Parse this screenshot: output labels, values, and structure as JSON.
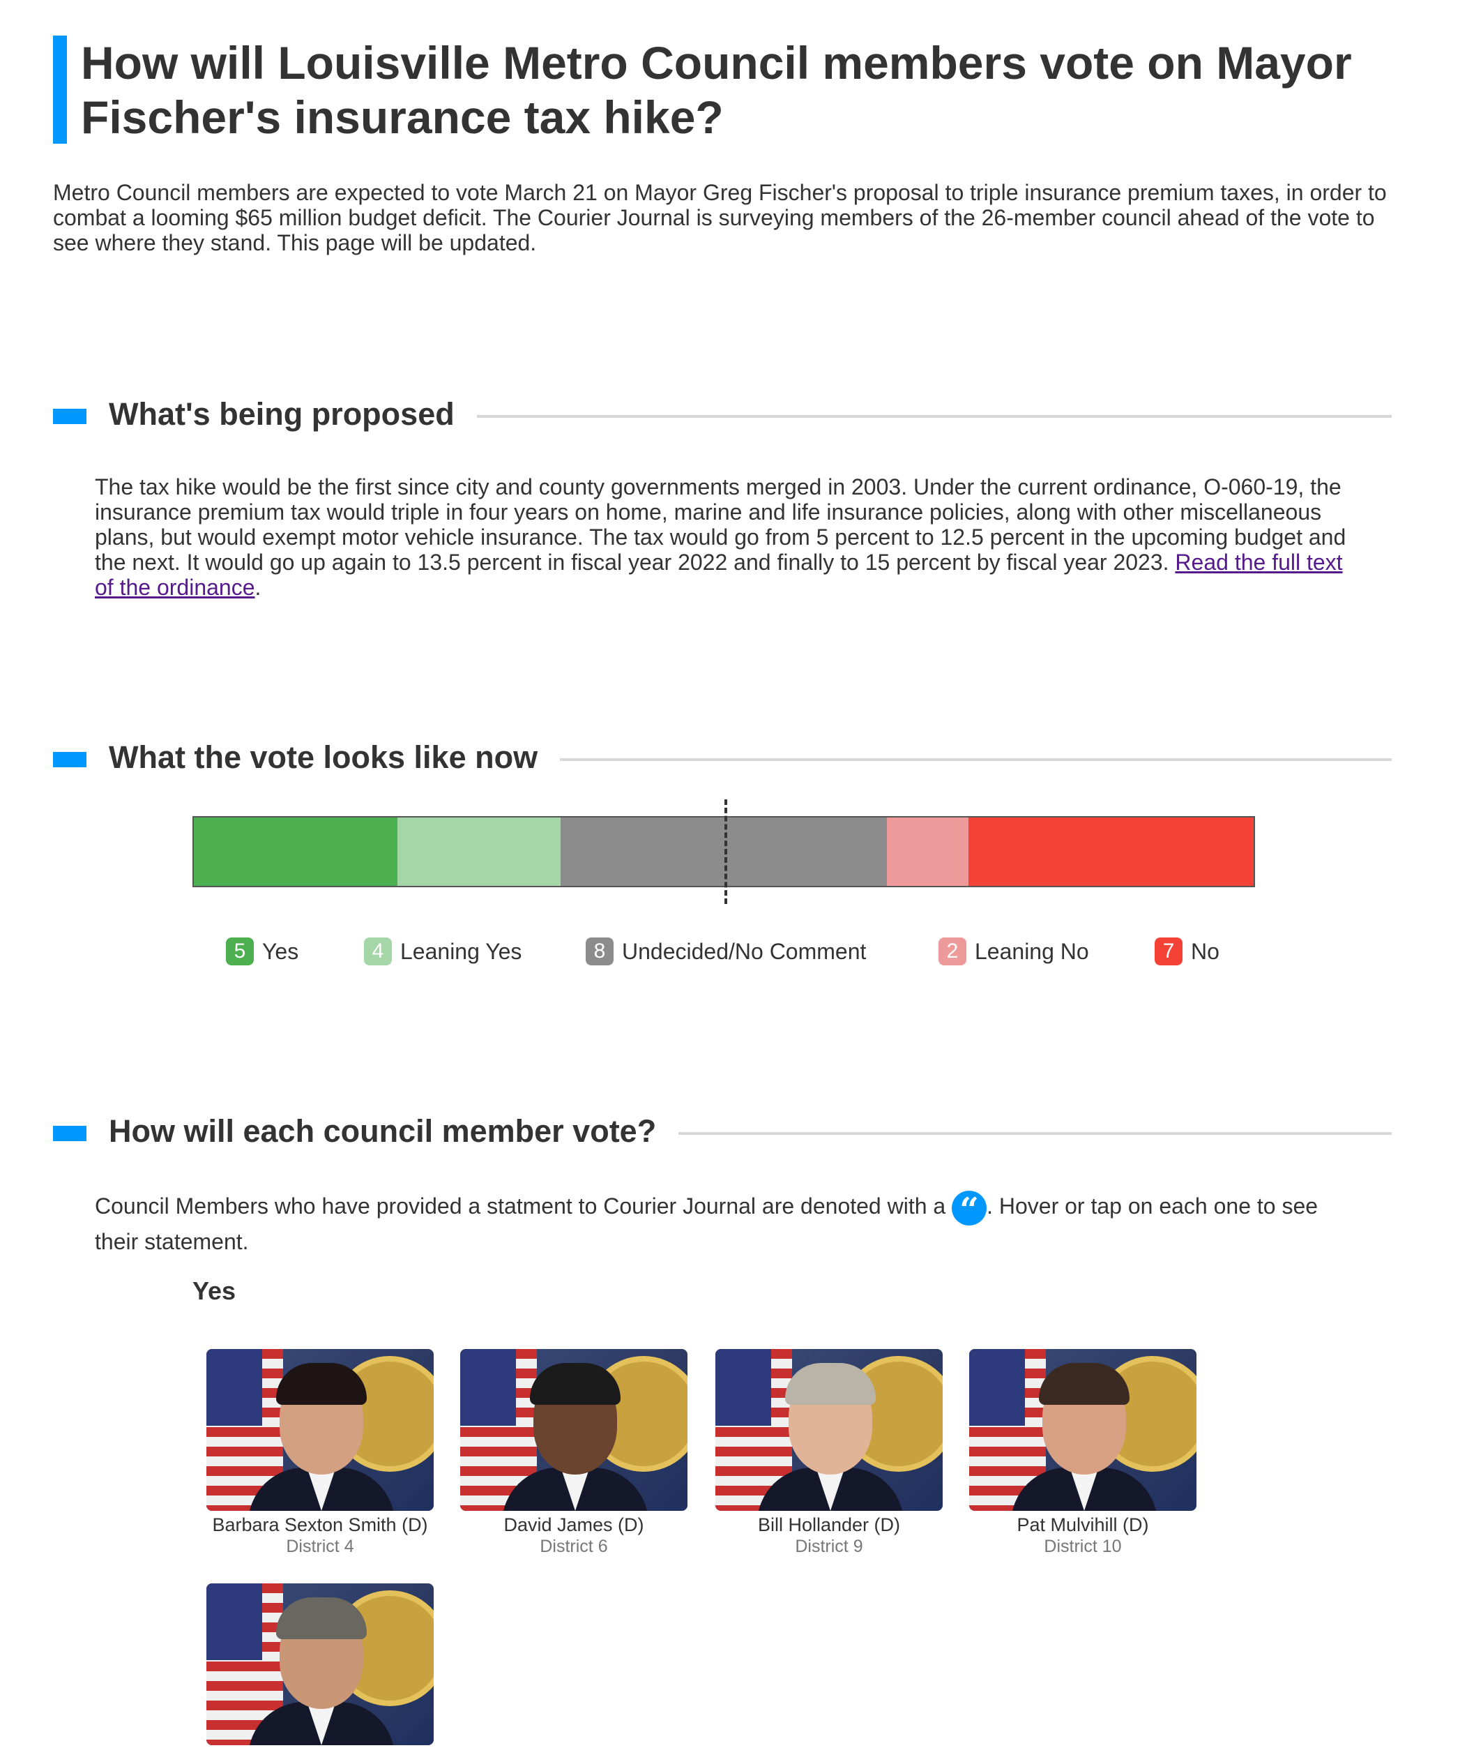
{
  "headline": "How will Louisville Metro Council members vote on Mayor Fischer's insurance tax hike?",
  "intro": "Metro Council members are expected to vote March 21 on Mayor Greg Fischer's proposal to triple insurance premium taxes, in order to combat a looming $65 million budget deficit. The Courier Journal is surveying members of the 26-member council ahead of the vote to see where they stand. This page will be updated.",
  "sections": {
    "proposed": {
      "title": "What's being proposed",
      "text": "The tax hike would be the first since city and county governments merged in 2003. Under the current ordinance, O-060-19, the insurance premium tax would triple in four years on home, marine and life insurance policies, along with other miscellaneous plans, but would exempt motor vehicle insurance. The tax would go from 5 percent to 12.5 percent in the upcoming budget and the next. It would go up again to 13.5 percent in fiscal year 2022 and finally to 15 percent by fiscal year 2023. ",
      "link_text": "Read the full text of the ordinance",
      "after_link": "."
    },
    "vote": {
      "title": "What the vote looks like now"
    },
    "members": {
      "title": "How will each council member vote?",
      "note_before": "Council Members who have provided a statment to Courier Journal are denoted with a ",
      "note_after": ". Hover or tap on each one to see their statement.",
      "quote_glyph": "“",
      "group_label": "Yes"
    }
  },
  "vote_tally": [
    {
      "label": "Yes",
      "count": "5",
      "color": "#4caf50"
    },
    {
      "label": "Leaning Yes",
      "count": "4",
      "color": "#a5d6a7"
    },
    {
      "label": "Undecided/No Comment",
      "count": "8",
      "color": "#8c8c8c"
    },
    {
      "label": "Leaning No",
      "count": "2",
      "color": "#ef9a9a"
    },
    {
      "label": "No",
      "count": "7",
      "color": "#f44336"
    }
  ],
  "members_yes": [
    {
      "name": "Barbara Sexton Smith (D)",
      "district": "District 4"
    },
    {
      "name": "David James (D)",
      "district": "District 6"
    },
    {
      "name": "Bill Hollander (D)",
      "district": "District 9"
    },
    {
      "name": "Pat Mulvihill (D)",
      "district": "District 10"
    },
    {
      "name": "",
      "district": ""
    }
  ],
  "colors": {
    "accent": "#0098fe",
    "link": "#551a8b"
  }
}
